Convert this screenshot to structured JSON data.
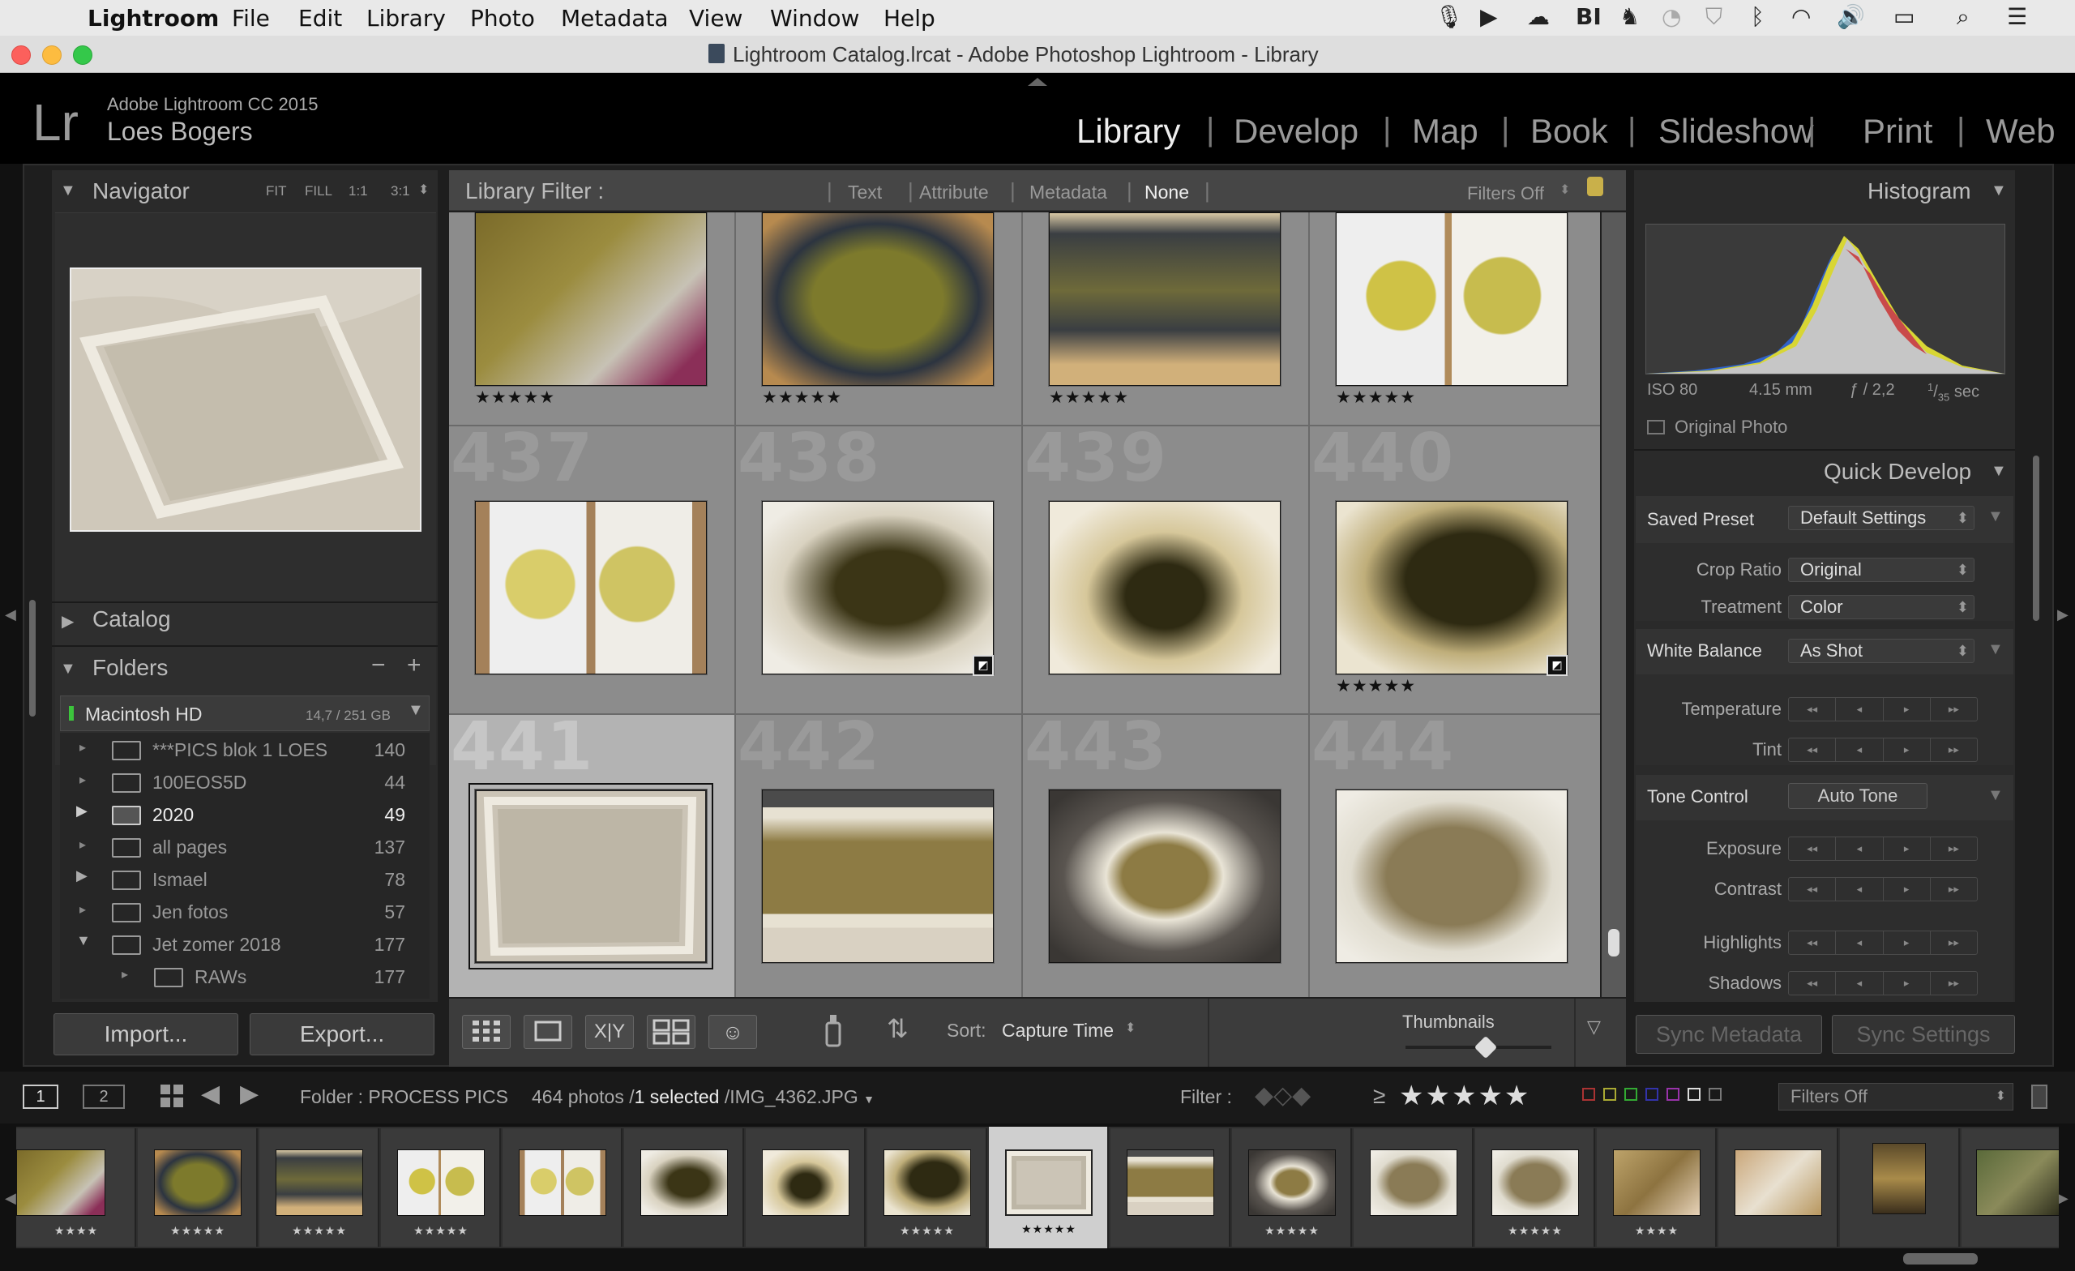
{
  "menubar": {
    "app": "Lightroom",
    "items": [
      "File",
      "Edit",
      "Library",
      "Photo",
      "Metadata",
      "View",
      "Window",
      "Help"
    ],
    "status_icons": [
      "microphone-icon",
      "video-icon",
      "cloud-icon",
      "bi-icon",
      "evernote-icon",
      "sync-icon",
      "shield-icon",
      "bluetooth-icon",
      "wifi-icon",
      "volume-icon",
      "battery-icon",
      "search-icon",
      "list-icon"
    ]
  },
  "window": {
    "title": "Lightroom Catalog.lrcat - Adobe Photoshop Lightroom - Library"
  },
  "identity": {
    "product": "Adobe Lightroom CC 2015",
    "user": "Loes Bogers",
    "logo": "Lr"
  },
  "modules": [
    "Library",
    "Develop",
    "Map",
    "Book",
    "Slideshow",
    "Print",
    "Web"
  ],
  "active_module": "Library",
  "navigator": {
    "title": "Navigator",
    "zoom": [
      "FIT",
      "FILL",
      "1:1",
      "3:1"
    ]
  },
  "catalog": {
    "title": "Catalog"
  },
  "folders": {
    "title": "Folders",
    "drive": {
      "name": "Macintosh HD",
      "usage": "14,7 / 251 GB"
    },
    "items": [
      {
        "name": "***PICS blok 1 LOES",
        "count": "140"
      },
      {
        "name": "100EOS5D",
        "count": "44"
      },
      {
        "name": "2020",
        "count": "49"
      },
      {
        "name": "all pages",
        "count": "137"
      },
      {
        "name": "Ismael",
        "count": "78"
      },
      {
        "name": "Jen fotos",
        "count": "57"
      },
      {
        "name": "Jet zomer 2018",
        "count": "177"
      },
      {
        "name": "RAWs",
        "count": "177"
      }
    ]
  },
  "left_buttons": {
    "import": "Import...",
    "export": "Export..."
  },
  "library_filter": {
    "label": "Library Filter :",
    "options": [
      "Text",
      "Attribute",
      "Metadata",
      "None"
    ],
    "active": "None",
    "preset": "Filters Off"
  },
  "grid": {
    "rows": [
      {
        "nums": [
          "433",
          "434",
          "435",
          "436"
        ],
        "stars": [
          "★★★★★",
          "★★★★★",
          "★★★★★",
          "★★★★★"
        ]
      },
      {
        "nums": [
          "437",
          "438",
          "439",
          "440"
        ],
        "stars": [
          "",
          "",
          "",
          "★★★★★"
        ]
      },
      {
        "nums": [
          "441",
          "442",
          "443",
          "444"
        ],
        "stars": [
          "",
          "",
          "",
          ""
        ]
      }
    ]
  },
  "toolbar": {
    "sort_label": "Sort:",
    "sort_value": "Capture Time",
    "thumbnails_label": "Thumbnails",
    "thumbnail_size": 0.55
  },
  "histogram": {
    "title": "Histogram",
    "iso": "ISO 80",
    "focal": "4.15 mm",
    "aperture": "ƒ / 2,2",
    "shutter_num": "1",
    "shutter_den": "35",
    "shutter_unit": "sec",
    "original_photo": "Original Photo"
  },
  "quick_develop": {
    "title": "Quick Develop",
    "saved_preset_label": "Saved Preset",
    "saved_preset_value": "Default Settings",
    "crop_label": "Crop Ratio",
    "crop_value": "Original",
    "treatment_label": "Treatment",
    "treatment_value": "Color",
    "wb_label": "White Balance",
    "wb_value": "As Shot",
    "temperature": "Temperature",
    "tint": "Tint",
    "tone_label": "Tone Control",
    "auto_tone": "Auto Tone",
    "exposure": "Exposure",
    "contrast": "Contrast",
    "highlights": "Highlights",
    "shadows": "Shadows"
  },
  "sync": {
    "metadata": "Sync Metadata",
    "settings": "Sync Settings"
  },
  "filmstrip_bar": {
    "screen1": "1",
    "screen2": "2",
    "folder": "Folder : PROCESS PICS",
    "photos": "464 photos /",
    "selected": "1 selected",
    "file": "/IMG_4362.JPG",
    "filter_label": "Filter :",
    "filter_value": "Filters Off",
    "rating_op": "≥",
    "rating_stars": "★★★★★"
  },
  "filmstrip": {
    "stars": [
      "★★★★",
      "★★★★★",
      "★★★★★",
      "★★★★★",
      "",
      "",
      "",
      "★★★★★",
      "★★★★★",
      "",
      "★★★★★",
      "",
      "★★★★★",
      "★★★★",
      "",
      ""
    ]
  },
  "colors": {
    "accent": "#ffffff",
    "panel": "#2a2a2a",
    "grid_bg": "#8c8c8c",
    "selected_cell": "#b3b3b3"
  }
}
